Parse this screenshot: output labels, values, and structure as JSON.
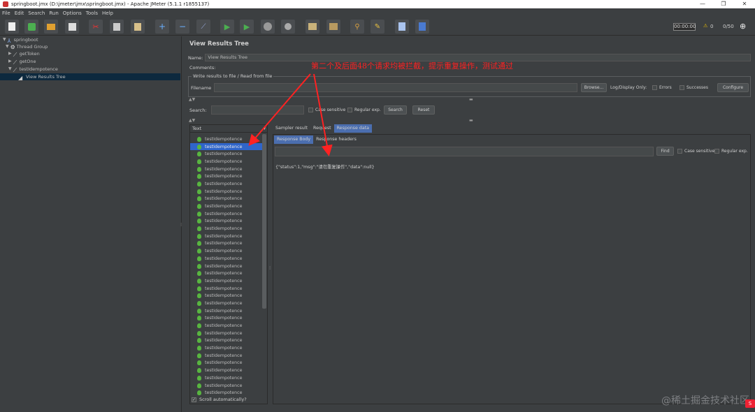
{
  "window": {
    "title": "springboot.jmx (D:\\jmeter\\jmx\\springboot.jmx) - Apache JMeter (5.1.1 r1855137)",
    "controls": [
      "—",
      "❐",
      "✕"
    ]
  },
  "menu": [
    "File",
    "Edit",
    "Search",
    "Run",
    "Options",
    "Tools",
    "Help"
  ],
  "toolbar": {
    "timer": "00:00:00",
    "warning_count": "0",
    "threads": "0/50"
  },
  "tree": [
    {
      "label": "springboot",
      "icon": "testplan-icon",
      "color": "#8ab4f8"
    },
    {
      "label": "Thread Group",
      "icon": "gear-icon",
      "color": "#cfcfcf"
    },
    {
      "label": "getToken",
      "icon": "sampler-icon",
      "color": "#cfcfcf"
    },
    {
      "label": "getOne",
      "icon": "sampler-icon",
      "color": "#cfcfcf"
    },
    {
      "label": "testIdempotence",
      "icon": "sampler-icon",
      "color": "#cfcfcf"
    },
    {
      "label": "View Results Tree",
      "icon": "listener-icon",
      "color": "#cfcfcf"
    }
  ],
  "panel": {
    "title": "View Results Tree",
    "name_label": "Name:",
    "name_value": "View Results Tree",
    "comments_label": "Comments:",
    "file_legend": "Write results to file / Read from file",
    "filename_label": "Filename",
    "browse": "Browse...",
    "log_display": "Log/Display Only:",
    "errors": "Errors",
    "successes": "Successes",
    "configure": "Configure",
    "search_label": "Search:",
    "case_sensitive": "Case sensitive",
    "regular_exp": "Regular exp.",
    "search_btn": "Search",
    "reset_btn": "Reset"
  },
  "results": {
    "header": "Text",
    "item_label": "testIdempotence",
    "selected_index": 1,
    "scroll_auto": "Scroll automatically?"
  },
  "detail": {
    "tabs": [
      "Sampler result",
      "Request",
      "Response data"
    ],
    "active_tab": 2,
    "subtabs": [
      "Response Body",
      "Response headers"
    ],
    "active_subtab": 0,
    "find_btn": "Find",
    "case_sensitive": "Case sensitive",
    "regular_exp": "Regular exp.",
    "response_text": "{\"status\":1,\"msg\":\"请勿重复操作\",\"data\":null}"
  },
  "annotation": "第二个及后面48个请求均被拦截，提示重复操作，测试通过",
  "watermark": "@稀土掘金技术社区",
  "colors": {
    "background": "#3c3f41",
    "selection": "#2f65ca",
    "success_icon": "#58b540",
    "annotation": "#ff2222"
  }
}
